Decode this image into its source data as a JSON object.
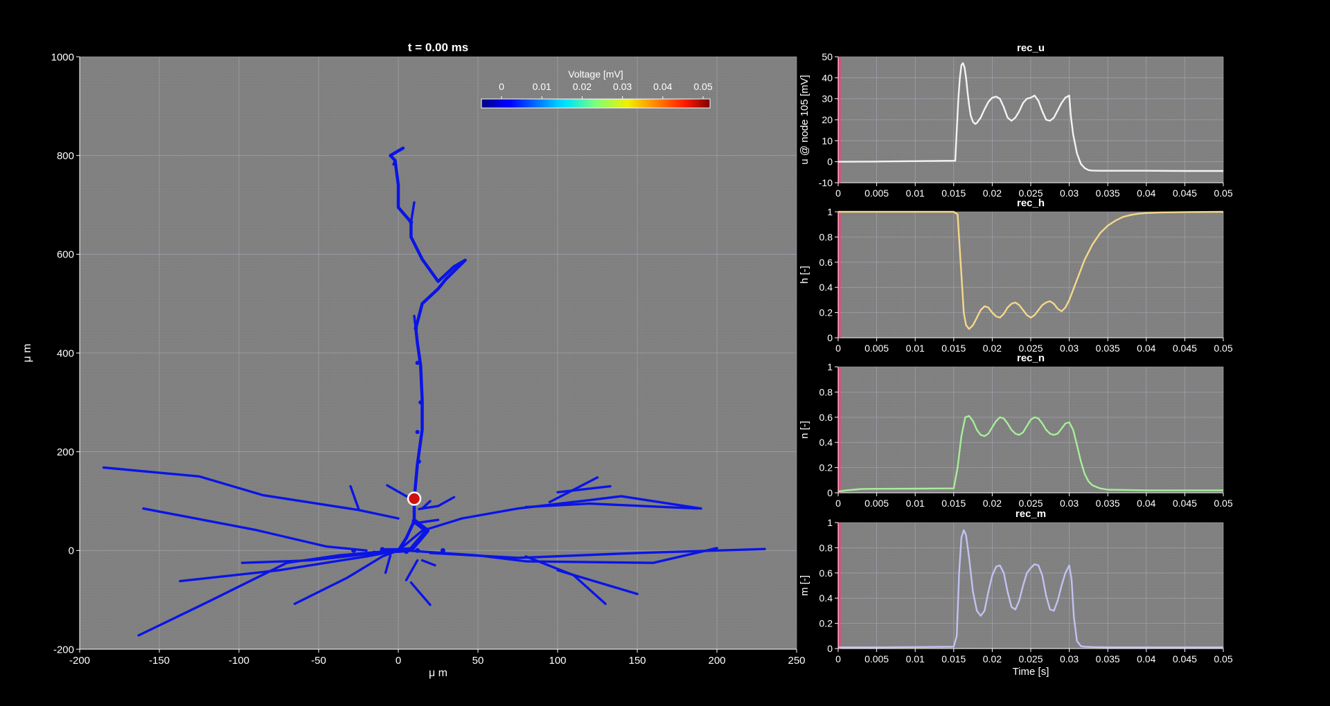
{
  "colors": {
    "background": "#000000",
    "plot_bg": "#808080",
    "grid": "#a8a8b8",
    "neuron": "#0a14e6",
    "marker_fill": "#d01010",
    "marker_edge": "#ffffff",
    "time_cursor": "#ff3b7a",
    "rec_u": "#f4f4f4",
    "rec_h": "#f5d98a",
    "rec_n": "#a8ee9a",
    "rec_m": "#c2c2f2"
  },
  "chart_data": [
    {
      "type": "line",
      "id": "morphology",
      "title": "t = 0.00 ms",
      "xlabel": "μ m",
      "ylabel": "μ m",
      "xlim": [
        -200,
        250
      ],
      "ylim": [
        -200,
        1000
      ],
      "xticks": [
        -200,
        -150,
        -100,
        -50,
        0,
        50,
        100,
        150,
        200,
        250
      ],
      "yticks": [
        -200,
        0,
        200,
        400,
        600,
        800,
        1000
      ],
      "grid": true,
      "recording_marker": {
        "x": 10,
        "y": 105
      },
      "colorbar": {
        "label": "Voltage [mV]",
        "ticks": [
          0,
          0.01,
          0.02,
          0.03,
          0.04,
          0.05
        ],
        "tick_labels": [
          "0",
          "0.01",
          "0.02",
          "0.03",
          "0.04",
          "0.05"
        ],
        "range": [
          0,
          0.05
        ],
        "placement": "top-right",
        "colormap": "jet"
      },
      "segments": [
        [
          [
            -185,
            168
          ],
          [
            -125,
            150
          ],
          [
            -85,
            112
          ],
          [
            -25,
            82
          ],
          [
            0,
            65
          ]
        ],
        [
          [
            -160,
            85
          ],
          [
            -90,
            42
          ],
          [
            -45,
            8
          ],
          [
            -20,
            0
          ]
        ],
        [
          [
            -98,
            -25
          ],
          [
            -55,
            -20
          ],
          [
            0,
            0
          ]
        ],
        [
          [
            -137,
            -62
          ],
          [
            -75,
            -40
          ],
          [
            -20,
            -12
          ],
          [
            0,
            0
          ]
        ],
        [
          [
            -163,
            -172
          ],
          [
            -120,
            -105
          ],
          [
            -70,
            -25
          ],
          [
            -38,
            -10
          ],
          [
            -10,
            -2
          ]
        ],
        [
          [
            -65,
            -108
          ],
          [
            -32,
            -55
          ],
          [
            -10,
            -12
          ],
          [
            0,
            0
          ]
        ],
        [
          [
            -30,
            130
          ],
          [
            -25,
            85
          ]
        ],
        [
          [
            -7,
            132
          ],
          [
            5,
            110
          ],
          [
            10,
            105
          ]
        ],
        [
          [
            20,
            100
          ],
          [
            15,
            85
          ]
        ],
        [
          [
            35,
            108
          ],
          [
            25,
            90
          ],
          [
            13,
            84
          ]
        ],
        [
          [
            -5,
            -10
          ],
          [
            -8,
            -45
          ]
        ],
        [
          [
            8,
            -65
          ],
          [
            20,
            -110
          ]
        ],
        [
          [
            12,
            -20
          ],
          [
            5,
            -60
          ]
        ],
        [
          [
            0,
            0
          ],
          [
            15,
            40
          ],
          [
            40,
            65
          ],
          [
            75,
            85
          ],
          [
            120,
            102
          ],
          [
            140,
            110
          ],
          [
            190,
            85
          ]
        ],
        [
          [
            80,
            88
          ],
          [
            120,
            95
          ],
          [
            188,
            85
          ]
        ],
        [
          [
            95,
            98
          ],
          [
            125,
            148
          ]
        ],
        [
          [
            100,
            118
          ],
          [
            133,
            130
          ]
        ],
        [
          [
            10,
            55
          ],
          [
            25,
            62
          ]
        ],
        [
          [
            5,
            0
          ],
          [
            50,
            -10
          ],
          [
            80,
            -22
          ],
          [
            160,
            -25
          ],
          [
            200,
            5
          ]
        ],
        [
          [
            20,
            -5
          ],
          [
            75,
            -15
          ],
          [
            150,
            -5
          ],
          [
            230,
            3
          ]
        ],
        [
          [
            80,
            -12
          ],
          [
            110,
            -50
          ],
          [
            130,
            -108
          ]
        ],
        [
          [
            100,
            -40
          ],
          [
            150,
            -88
          ]
        ],
        [
          [
            15,
            -20
          ],
          [
            23,
            -30
          ]
        ],
        [
          [
            0,
            0
          ],
          [
            5,
            25
          ],
          [
            10,
            60
          ],
          [
            10,
            105
          ],
          [
            12,
            175
          ],
          [
            15,
            245
          ],
          [
            15,
            305
          ],
          [
            14,
            375
          ],
          [
            12,
            420
          ],
          [
            11,
            450
          ],
          [
            15,
            500
          ],
          [
            25,
            530
          ],
          [
            30,
            550
          ],
          [
            42,
            588
          ],
          [
            35,
            575
          ],
          [
            25,
            545
          ],
          [
            15,
            590
          ],
          [
            8,
            635
          ],
          [
            8,
            665
          ],
          [
            0,
            695
          ],
          [
            0,
            740
          ],
          [
            -2,
            790
          ],
          [
            -5,
            800
          ],
          [
            3,
            815
          ]
        ],
        [
          [
            12,
            420
          ],
          [
            10,
            475
          ]
        ],
        [
          [
            8,
            665
          ],
          [
            10,
            705
          ]
        ],
        [
          [
            -5,
            800
          ],
          [
            -2,
            790
          ],
          [
            -3,
            782
          ]
        ]
      ]
    },
    {
      "type": "line",
      "id": "rec_u",
      "title": "rec_u",
      "xlabel": "",
      "ylabel": "u @ node 105 [mV]",
      "xlim": [
        0,
        0.05
      ],
      "ylim": [
        -10,
        50
      ],
      "xticks": [
        0,
        0.005,
        0.01,
        0.015,
        0.02,
        0.025,
        0.03,
        0.035,
        0.04,
        0.05
      ],
      "xtick_labels": [
        "0",
        "0.005",
        "0.01",
        "0.015",
        "0.02",
        "0.025",
        "0.03",
        "0.035",
        "0.04",
        "0.045",
        "0.05"
      ],
      "yticks": [
        -10,
        0,
        10,
        20,
        30,
        40,
        50
      ],
      "grid": true,
      "cursor_x": 0,
      "series": [
        {
          "x": [
            0,
            0.005,
            0.01,
            0.0152,
            0.0154,
            0.0156,
            0.0158,
            0.016,
            0.0162,
            0.0164,
            0.0166,
            0.0168,
            0.017,
            0.0172,
            0.0175,
            0.0178,
            0.018,
            0.0185,
            0.019,
            0.0195,
            0.02,
            0.0205,
            0.021,
            0.0215,
            0.022,
            0.0225,
            0.023,
            0.0235,
            0.024,
            0.0245,
            0.025,
            0.0255,
            0.026,
            0.0265,
            0.027,
            0.0275,
            0.028,
            0.0285,
            0.029,
            0.0295,
            0.03,
            0.0302,
            0.0305,
            0.031,
            0.0315,
            0.032,
            0.0325,
            0.033,
            0.034,
            0.035,
            0.04,
            0.045,
            0.05
          ],
          "y": [
            0,
            0.1,
            0.3,
            0.5,
            15,
            30,
            40,
            46,
            47,
            45,
            40,
            33,
            27,
            22,
            19,
            18,
            18.5,
            21,
            25,
            28.5,
            30.5,
            31,
            30,
            26,
            21,
            19.5,
            21,
            24,
            28,
            30,
            30.5,
            31.5,
            29,
            24,
            20,
            19.5,
            21,
            24.5,
            28,
            30.5,
            31.5,
            22,
            13,
            4,
            -1,
            -3,
            -4,
            -4.2,
            -4.3,
            -4.3,
            -4.3,
            -4.4,
            -4.4
          ]
        }
      ]
    },
    {
      "type": "line",
      "id": "rec_h",
      "title": "rec_h",
      "xlabel": "",
      "ylabel": "h [-]",
      "xlim": [
        0,
        0.05
      ],
      "ylim": [
        0,
        1
      ],
      "xticks": [
        0,
        0.005,
        0.01,
        0.015,
        0.02,
        0.025,
        0.03,
        0.035,
        0.04,
        0.045,
        0.05
      ],
      "xtick_labels": [
        "0",
        "0.005",
        "0.01",
        "0.015",
        "0.02",
        "0.025",
        "0.03",
        "0.035",
        "0.04",
        "0.045",
        "0.05"
      ],
      "yticks": [
        0,
        0.2,
        0.4,
        0.6,
        0.8,
        1
      ],
      "grid": true,
      "cursor_x": 0,
      "series": [
        {
          "x": [
            0,
            0.005,
            0.01,
            0.015,
            0.0155,
            0.016,
            0.0163,
            0.0166,
            0.017,
            0.0175,
            0.018,
            0.0185,
            0.019,
            0.0195,
            0.02,
            0.0205,
            0.021,
            0.0215,
            0.022,
            0.0225,
            0.023,
            0.0235,
            0.024,
            0.0245,
            0.025,
            0.0255,
            0.026,
            0.0265,
            0.027,
            0.0275,
            0.028,
            0.0285,
            0.029,
            0.0295,
            0.03,
            0.0305,
            0.031,
            0.0315,
            0.032,
            0.033,
            0.034,
            0.035,
            0.036,
            0.037,
            0.038,
            0.039,
            0.04,
            0.042,
            0.045,
            0.05
          ],
          "y": [
            1,
            1,
            1,
            1,
            0.98,
            0.5,
            0.2,
            0.1,
            0.07,
            0.1,
            0.16,
            0.22,
            0.25,
            0.24,
            0.2,
            0.17,
            0.16,
            0.19,
            0.24,
            0.27,
            0.28,
            0.26,
            0.22,
            0.18,
            0.16,
            0.18,
            0.22,
            0.26,
            0.28,
            0.29,
            0.27,
            0.23,
            0.21,
            0.24,
            0.3,
            0.38,
            0.46,
            0.54,
            0.62,
            0.74,
            0.83,
            0.89,
            0.93,
            0.96,
            0.975,
            0.985,
            0.99,
            0.995,
            0.998,
            1
          ]
        }
      ]
    },
    {
      "type": "line",
      "id": "rec_n",
      "title": "rec_n",
      "xlabel": "",
      "ylabel": "n [-]",
      "xlim": [
        0,
        0.05
      ],
      "ylim": [
        0,
        1
      ],
      "xticks": [
        0,
        0.005,
        0.01,
        0.015,
        0.02,
        0.025,
        0.03,
        0.035,
        0.04,
        0.045,
        0.05
      ],
      "xtick_labels": [
        "0",
        "0.005",
        "0.01",
        "0.015",
        "0.02",
        "0.025",
        "0.03",
        "0.035",
        "0.04",
        "0.045",
        "0.05"
      ],
      "yticks": [
        0,
        0.2,
        0.4,
        0.6,
        0.8,
        1
      ],
      "grid": true,
      "cursor_x": 0,
      "series": [
        {
          "x": [
            0,
            0.0005,
            0.001,
            0.002,
            0.003,
            0.005,
            0.01,
            0.015,
            0.0155,
            0.016,
            0.0165,
            0.017,
            0.0175,
            0.018,
            0.0185,
            0.019,
            0.0195,
            0.02,
            0.0205,
            0.021,
            0.0215,
            0.022,
            0.0225,
            0.023,
            0.0235,
            0.024,
            0.0245,
            0.025,
            0.0255,
            0.026,
            0.0265,
            0.027,
            0.0275,
            0.028,
            0.0285,
            0.029,
            0.0295,
            0.03,
            0.0305,
            0.031,
            0.0315,
            0.032,
            0.0325,
            0.033,
            0.034,
            0.035,
            0.04,
            0.045,
            0.05
          ],
          "y": [
            0.01,
            0.015,
            0.02,
            0.025,
            0.03,
            0.032,
            0.033,
            0.035,
            0.2,
            0.45,
            0.6,
            0.61,
            0.57,
            0.5,
            0.46,
            0.45,
            0.47,
            0.52,
            0.57,
            0.6,
            0.59,
            0.55,
            0.5,
            0.47,
            0.46,
            0.48,
            0.53,
            0.58,
            0.6,
            0.59,
            0.55,
            0.5,
            0.47,
            0.46,
            0.47,
            0.51,
            0.55,
            0.56,
            0.5,
            0.38,
            0.25,
            0.15,
            0.09,
            0.06,
            0.035,
            0.025,
            0.02,
            0.02,
            0.02
          ]
        }
      ]
    },
    {
      "type": "line",
      "id": "rec_m",
      "title": "rec_m",
      "xlabel": "Time [s]",
      "ylabel": "m [-]",
      "xlim": [
        0,
        0.05
      ],
      "ylim": [
        0,
        1
      ],
      "xticks": [
        0,
        0.005,
        0.01,
        0.015,
        0.02,
        0.025,
        0.03,
        0.035,
        0.04,
        0.045,
        0.05
      ],
      "xtick_labels": [
        "0",
        "0.005",
        "0.01",
        "0.015",
        "0.02",
        "0.025",
        "0.03",
        "0.035",
        "0.04",
        "0.045",
        "0.05"
      ],
      "yticks": [
        0,
        0.2,
        0.4,
        0.6,
        0.8,
        1
      ],
      "grid": true,
      "cursor_x": 0,
      "series": [
        {
          "x": [
            0,
            0.005,
            0.01,
            0.015,
            0.0154,
            0.0157,
            0.016,
            0.0163,
            0.0166,
            0.017,
            0.0175,
            0.018,
            0.0185,
            0.019,
            0.0195,
            0.02,
            0.0205,
            0.021,
            0.0215,
            0.022,
            0.0225,
            0.023,
            0.0235,
            0.024,
            0.0245,
            0.025,
            0.0255,
            0.026,
            0.0265,
            0.027,
            0.0275,
            0.028,
            0.0285,
            0.029,
            0.0295,
            0.03,
            0.0303,
            0.0306,
            0.031,
            0.0315,
            0.032,
            0.033,
            0.035,
            0.04,
            0.045,
            0.05
          ],
          "y": [
            0.01,
            0.01,
            0.012,
            0.015,
            0.1,
            0.6,
            0.88,
            0.94,
            0.9,
            0.72,
            0.45,
            0.3,
            0.26,
            0.3,
            0.45,
            0.58,
            0.65,
            0.66,
            0.6,
            0.45,
            0.33,
            0.31,
            0.38,
            0.5,
            0.6,
            0.64,
            0.67,
            0.66,
            0.58,
            0.42,
            0.31,
            0.3,
            0.38,
            0.5,
            0.6,
            0.66,
            0.55,
            0.25,
            0.06,
            0.02,
            0.015,
            0.012,
            0.01,
            0.01,
            0.01,
            0.01
          ]
        }
      ]
    }
  ]
}
